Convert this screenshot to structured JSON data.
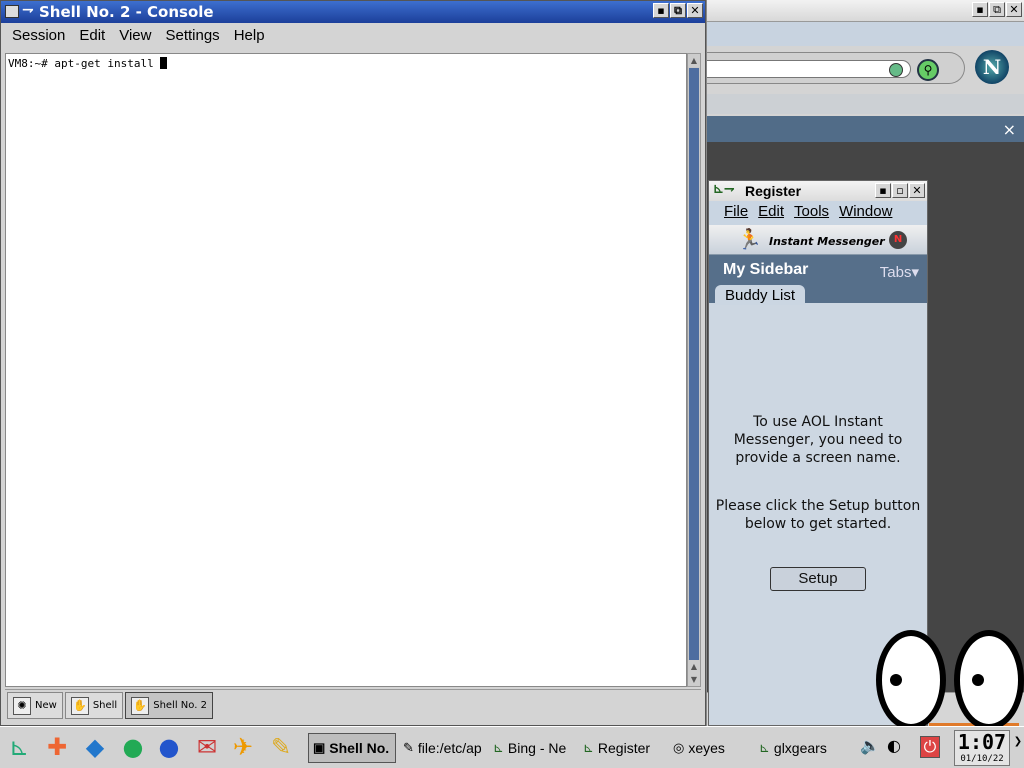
{
  "console": {
    "title": "Shell No. 2 - Console",
    "menu": [
      "Session",
      "Edit",
      "View",
      "Settings",
      "Help"
    ],
    "prompt_line": "VM8:~# apt-get install ",
    "tabs": [
      {
        "label": "New"
      },
      {
        "label": "Shell"
      },
      {
        "label": "Shell No. 2"
      }
    ]
  },
  "aim": {
    "title": "Register",
    "menu": [
      "File",
      "Edit",
      "Tools",
      "Window"
    ],
    "brand": "Instant Messenger",
    "sidebar_title": "My Sidebar",
    "tabs_label": "Tabs▾",
    "buddy_tab": "Buddy List",
    "message1": "To use AOL Instant Messenger, you need to provide a screen name.",
    "message2": "Please click the Setup button below to get started.",
    "setup_button": "Setup"
  },
  "browser": {
    "netscape_letter": "N",
    "sidebar_close": "×"
  },
  "taskbar": {
    "tasks": [
      {
        "label": "Shell No.",
        "icon": "terminal-icon"
      },
      {
        "label": "file:/etc/ap",
        "icon": "pencil-icon"
      },
      {
        "label": "Bing - Ne",
        "icon": "mozilla-icon"
      },
      {
        "label": "Register",
        "icon": "mozilla-icon"
      },
      {
        "label": "xeyes",
        "icon": "eyes-icon"
      },
      {
        "label": "glxgears",
        "icon": "mozilla-icon"
      }
    ],
    "clock_time": "1:07",
    "clock_date": "01/10/22"
  },
  "colors": {
    "console_title": "#1c3f9a",
    "aim_sidebar": "#566f8a",
    "scroll_thumb": "#4d6da0"
  }
}
